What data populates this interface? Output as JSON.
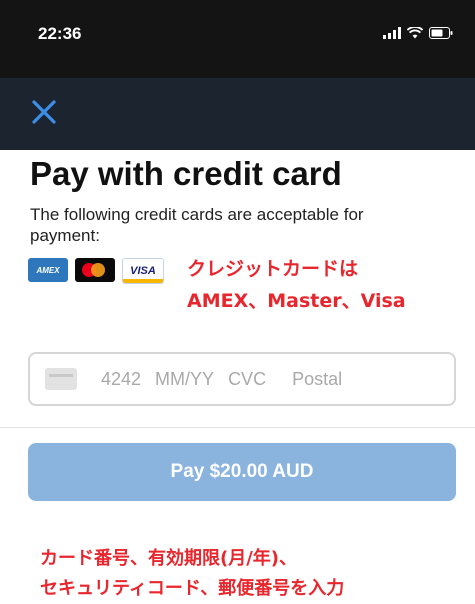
{
  "status_bar": {
    "time": "22:36"
  },
  "nav": {
    "close_icon": "close-icon"
  },
  "page": {
    "title": "Pay with credit card",
    "subtitle": "The following credit cards are acceptable for payment:"
  },
  "accepted_cards": [
    {
      "name": "amex",
      "label": "AMEX"
    },
    {
      "name": "mastercard",
      "label": ""
    },
    {
      "name": "visa",
      "label": "VISA"
    }
  ],
  "annotations": {
    "cards_line1": "クレジットカードは",
    "cards_line2": "AMEX、Master、Visa",
    "fields_line1": "カード番号、有効期限(月/年)、",
    "fields_line2": "セキュリティコード、郵便番号を入力"
  },
  "card_input": {
    "card_number": "4242",
    "expiry_placeholder": "MM/YY",
    "cvc_placeholder": "CVC",
    "postal_placeholder": "Postal"
  },
  "pay_button": {
    "label": "Pay $20.00 AUD"
  },
  "colors": {
    "status_bar": "#141414",
    "nav_bar": "#1c2430",
    "close_icon": "#3a8ee6",
    "pay_button": "#8ab3dd",
    "annotation": "#e8262d"
  }
}
